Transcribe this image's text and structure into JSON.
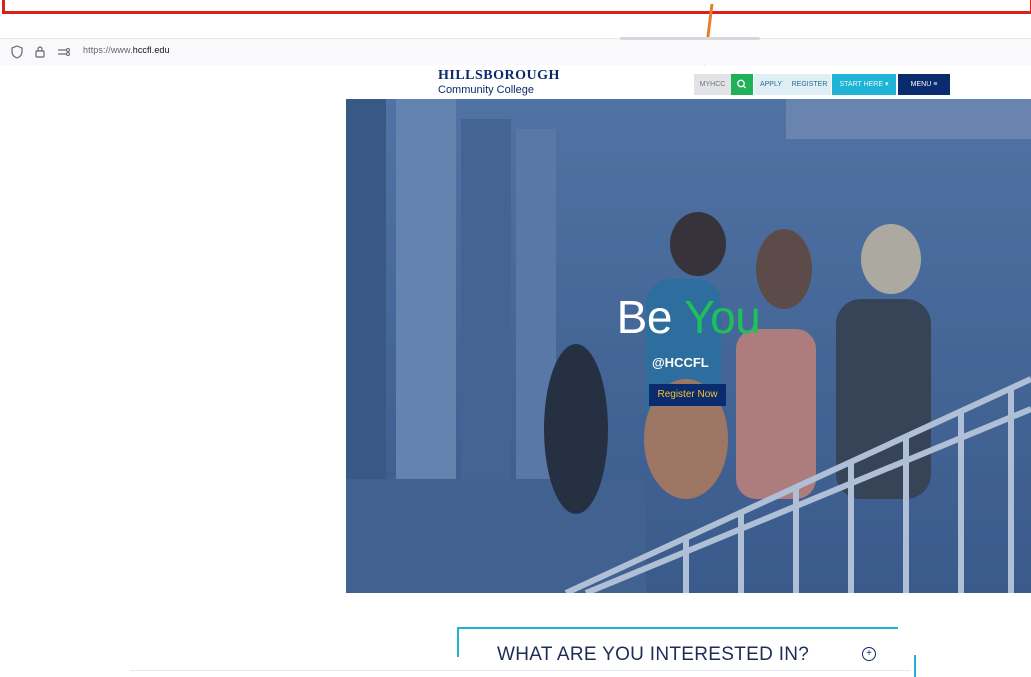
{
  "browser": {
    "url_prefix": "https://www.",
    "url_domain": "hccfl.edu"
  },
  "header": {
    "logo_top": "HILLSBOROUGH",
    "logo_bottom": "Community College",
    "nav": {
      "myhcc": "MYHCC",
      "apply": "APPLY",
      "register": "REGISTER",
      "start_here": "START HERE",
      "menu": "MENU"
    }
  },
  "hero": {
    "title_word1": "Be",
    "title_word2": "You",
    "handle": "@HCCFL",
    "cta": "Register Now"
  },
  "interests": {
    "heading": "WHAT ARE YOU INTERESTED IN?",
    "expand_symbol": "+"
  },
  "colors": {
    "brand_navy": "#0b2b6f",
    "brand_green": "#1fbf5c",
    "brand_cyan": "#1fb3d6",
    "annotation_red": "#d9201f",
    "annotation_arrow": "#e87b2c"
  }
}
